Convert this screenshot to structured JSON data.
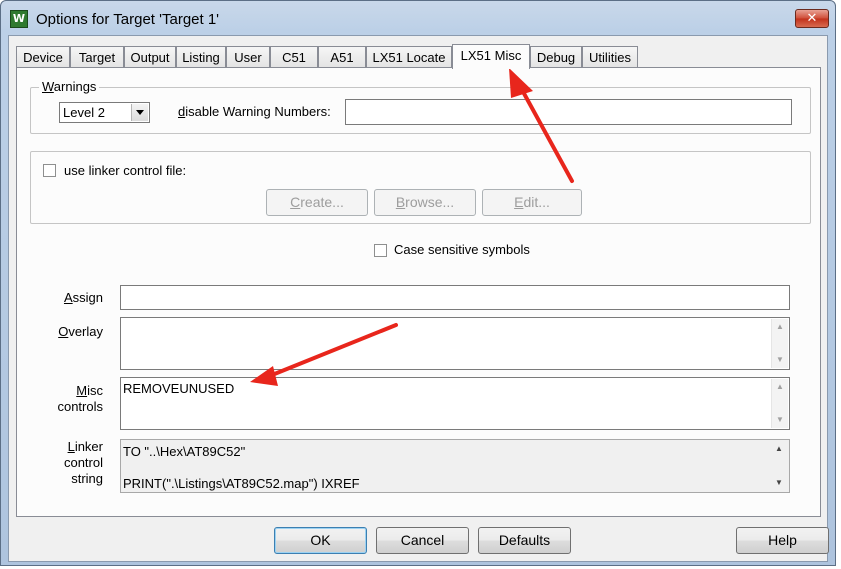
{
  "window": {
    "title": "Options for Target 'Target 1'",
    "close_glyph": "✕",
    "app_icon_text": "W"
  },
  "tabs": [
    {
      "label": "Device",
      "active": false
    },
    {
      "label": "Target",
      "active": false
    },
    {
      "label": "Output",
      "active": false
    },
    {
      "label": "Listing",
      "active": false
    },
    {
      "label": "User",
      "active": false
    },
    {
      "label": "C51",
      "active": false
    },
    {
      "label": "A51",
      "active": false
    },
    {
      "label": "LX51 Locate",
      "active": false
    },
    {
      "label": "LX51 Misc",
      "active": true
    },
    {
      "label": "Debug",
      "active": false
    },
    {
      "label": "Utilities",
      "active": false
    }
  ],
  "warnings": {
    "group_label_first": "W",
    "group_label_rest": "arnings",
    "level_value": "Level 2",
    "disable_label_first": "d",
    "disable_label_rest": "isable Warning Numbers:",
    "disable_value": ""
  },
  "linker_control": {
    "checkbox_label": "use linker control file:",
    "checked": false,
    "create_first": "C",
    "create_rest": "reate...",
    "browse_first": "B",
    "browse_rest": "rowse...",
    "edit_first": "E",
    "edit_rest": "dit..."
  },
  "case_sensitive": {
    "label": "Case sensitive symbols",
    "checked": false
  },
  "assign": {
    "label_first": "A",
    "label_rest": "ssign",
    "value": ""
  },
  "overlay": {
    "label_first": "O",
    "label_rest": "verlay",
    "value": ""
  },
  "misc": {
    "label_first": "M",
    "label_rest": "isc",
    "label_line2": "controls",
    "value": "REMOVEUNUSED"
  },
  "linker_string": {
    "label_first": "L",
    "label_rest": "inker",
    "label_line2": "control",
    "label_line3": "string",
    "line1": "TO \"..\\Hex\\AT89C52\"",
    "line2": "PRINT(\".\\Listings\\AT89C52.map\") IXREF"
  },
  "buttons": {
    "ok": "OK",
    "cancel": "Cancel",
    "defaults": "Defaults",
    "help": "Help"
  },
  "icons": {
    "scroll_up": "▲",
    "scroll_down": "▼",
    "annotation_color": "#e8261c"
  }
}
